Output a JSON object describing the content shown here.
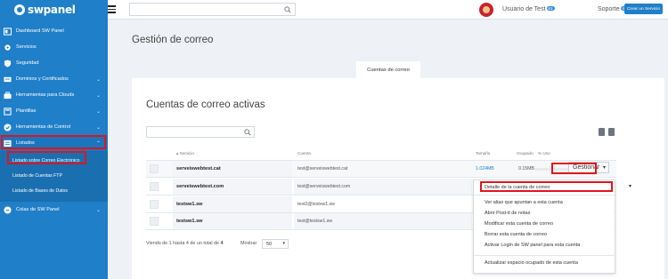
{
  "brand": {
    "name": "swpanel",
    "color": "#1f7fc8"
  },
  "sidebar": {
    "items": [
      {
        "label": "Dashboard SW Panel",
        "icon": "dashboard-icon"
      },
      {
        "label": "Servicios",
        "icon": "gear-icon"
      },
      {
        "label": "Seguridad",
        "icon": "shield-icon"
      },
      {
        "label": "Dominios y Certificados",
        "icon": "domains-icon"
      },
      {
        "label": "Herramientas para Clouds",
        "icon": "toolbox-icon"
      },
      {
        "label": "Plantillas",
        "icon": "templates-icon"
      },
      {
        "label": "Herramientas de Control",
        "icon": "check-icon"
      },
      {
        "label": "Listados",
        "icon": "list-icon"
      },
      {
        "label": "Colas de SW Panel",
        "icon": "queue-icon"
      }
    ],
    "sub_items": [
      {
        "label": "Listado sobre Correo Electrónico"
      },
      {
        "label": "Listado de Cuentas FTP"
      },
      {
        "label": "Listado de Bases de Datos"
      }
    ]
  },
  "topbar": {
    "search_placeholder": "",
    "user_label": "Usuario de Test",
    "user_badge": "61",
    "support_label": "Soporte",
    "support_badge": "495",
    "clear_button": "Crear un Servicio"
  },
  "page": {
    "title": "Gestión de correo",
    "tab": "Cuentas de correo"
  },
  "card": {
    "title": "Cuentas de correo activas",
    "columns": {
      "service": "Servicio",
      "account": "Cuenta",
      "size": "Tamaño",
      "used": "Ocupado",
      "pct": "% Uso"
    },
    "rows": [
      {
        "service": "serveiswebtest.cat",
        "account": "test@serveiswebtest.cat",
        "size": "1.024MB",
        "used": "0.15MB",
        "used_fraction": 0.0,
        "action": "Gestionar"
      },
      {
        "service": "serveiswebtest.com",
        "account": "test@serveiswebtest.com"
      },
      {
        "service": "testsw1.sw",
        "account": "test2@testsw1.sw"
      },
      {
        "service": "testsw1.sw",
        "account": "test@testsw1.sw"
      }
    ],
    "footer": {
      "showing": "Viendo de 1 hasta 4 de un total de ",
      "total": "4",
      "show_label": "Mostrar",
      "page_size": "50"
    }
  },
  "menu": {
    "items": [
      "Detalle de la cuenta de correo",
      "Ver alias que apuntan a esta cuenta",
      "Abrir Post-it de notas",
      "Modificar esta cuenta de correo",
      "Borrar esta cuenta de correo",
      "Activar Login de SW panel para esta cuenta",
      "Actualizar espacio ocupado de esta cuenta"
    ]
  },
  "colors": {
    "highlight": "#e2141b",
    "sidebar": "#1f7fc8",
    "background": "#eef1f5"
  }
}
